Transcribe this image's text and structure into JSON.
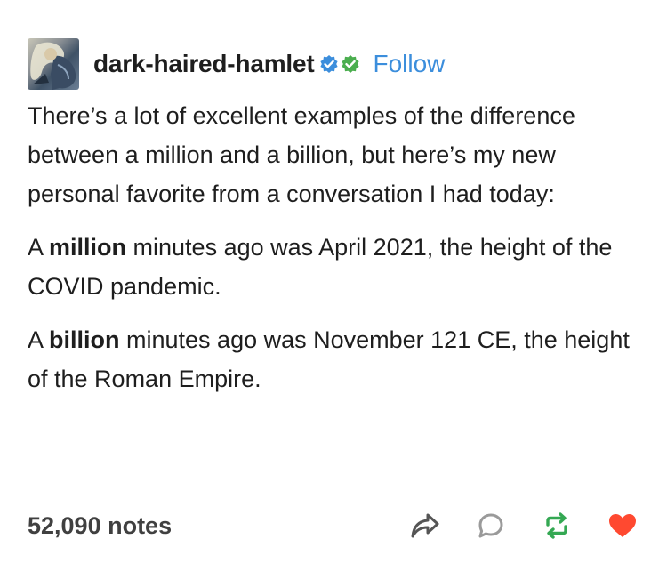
{
  "post": {
    "blog_name": "dark-haired-hamlet",
    "follow_label": "Follow",
    "paragraphs": {
      "p1": "There’s a lot of excellent examples of the difference between a million and a billion, but here’s my new personal favorite from a conversation I had today:",
      "p2": {
        "prefix": "A ",
        "bold": "million",
        "suffix": " minutes ago was April 2021, the height of the COVID pandemic."
      },
      "p3": {
        "prefix": "A ",
        "bold": "billion",
        "suffix": " minutes ago was November 121 CE, the height of the Roman Empire."
      }
    },
    "notes_count": "52,090 notes"
  },
  "icons": {
    "verified_badge": "verified-blue-badge-icon",
    "second_badge": "green-check-badge-icon",
    "share": "share-arrow-icon",
    "reply": "comment-bubble-icon",
    "reblog": "reblog-icon",
    "like": "heart-icon"
  },
  "colors": {
    "follow_link": "#3c8edc",
    "verified_badge": "#3c8edc",
    "green_badge": "#4bae4f",
    "reblog": "#34a853",
    "like": "#ff4930",
    "text": "#1e1e1e"
  }
}
